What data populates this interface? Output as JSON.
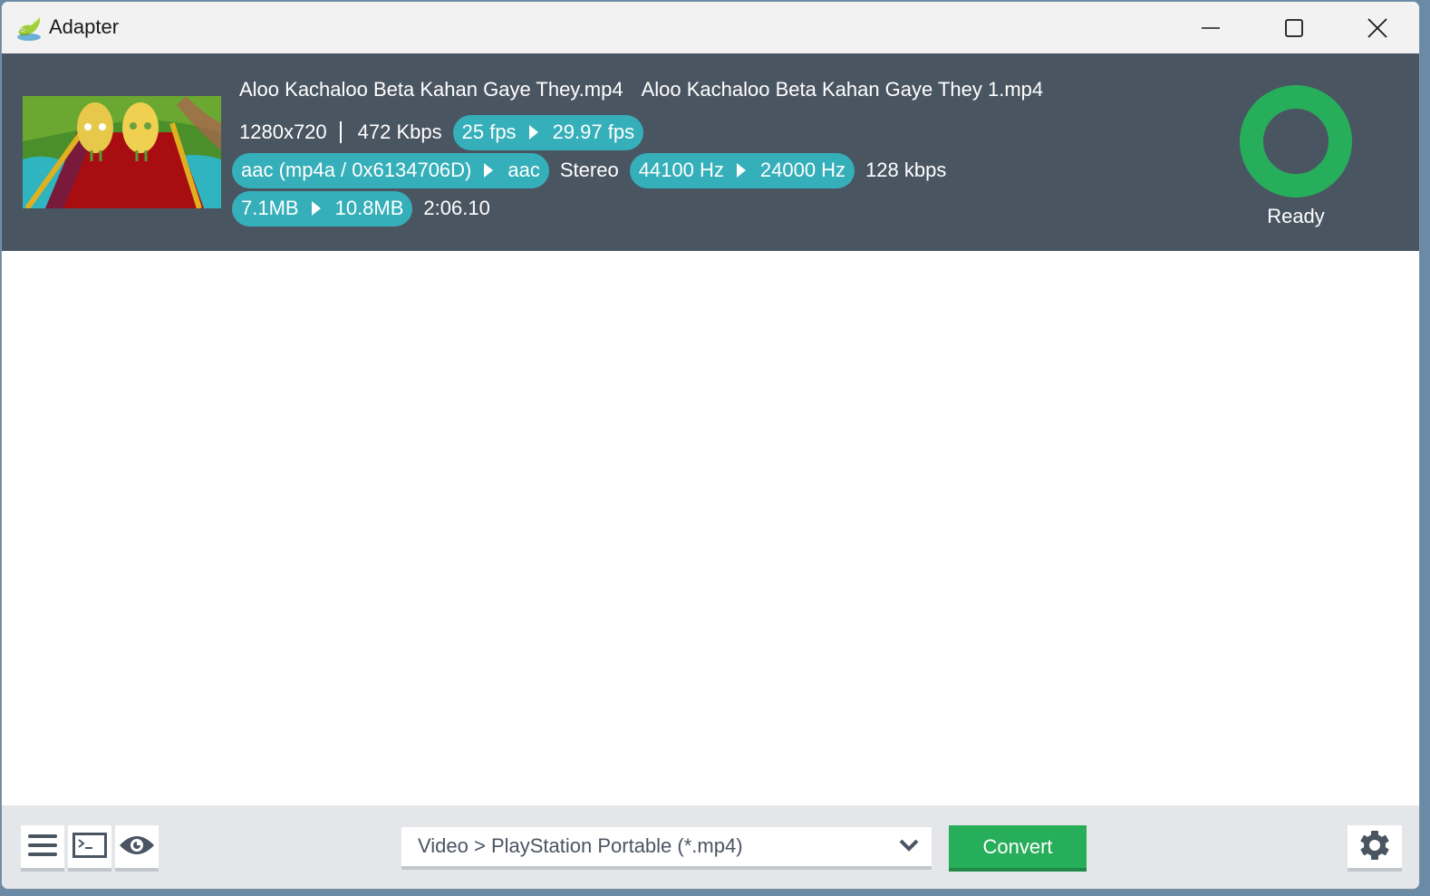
{
  "window": {
    "title": "Adapter",
    "controls": {
      "minimize": "minimize-icon",
      "maximize": "maximize-icon",
      "close": "close-icon"
    }
  },
  "file": {
    "input_name": "Aloo Kachaloo Beta Kahan Gaye They.mp4",
    "output_name": "Aloo Kachaloo Beta Kahan Gaye They 1.mp4",
    "resolution": "1280x720",
    "video_bitrate": "472 Kbps",
    "fps_from": "25 fps",
    "fps_to": "29.97 fps",
    "audio_codec_from": "aac (mp4a / 0x6134706D)",
    "audio_codec_to": "aac",
    "channels": "Stereo",
    "sample_rate_from": "44100 Hz",
    "sample_rate_to": "24000 Hz",
    "audio_bitrate": "128 kbps",
    "size_from": "7.1MB",
    "size_to": "10.8MB",
    "duration": "2:06.10",
    "status": "Ready",
    "status_color": "#27ae5a",
    "pill_color": "#35afb9"
  },
  "bottom": {
    "menu_icon": "hamburger-menu-icon",
    "terminal_icon": "terminal-icon",
    "preview_icon": "eye-icon",
    "format_value": "Video > PlayStation Portable (*.mp4)",
    "convert_label": "Convert",
    "settings_icon": "gear-icon",
    "convert_color": "#27ae5a"
  }
}
